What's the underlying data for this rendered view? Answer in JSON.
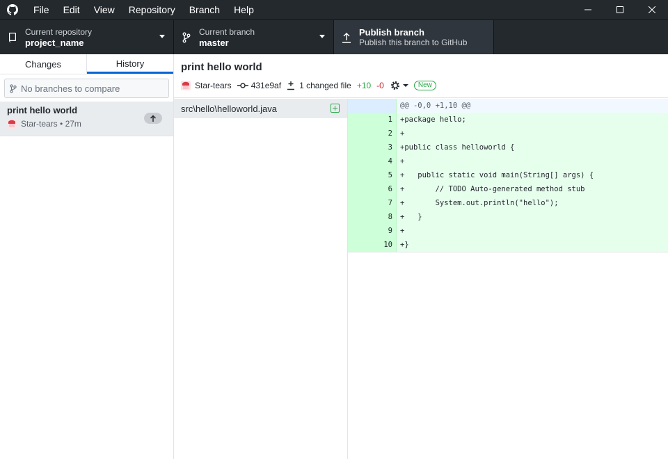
{
  "menu": [
    "File",
    "Edit",
    "View",
    "Repository",
    "Branch",
    "Help"
  ],
  "toolbar": {
    "repo_label": "Current repository",
    "repo_value": "project_name",
    "branch_label": "Current branch",
    "branch_value": "master",
    "publish_label": "Publish branch",
    "publish_desc": "Publish this branch to GitHub"
  },
  "sidebar": {
    "tabs": [
      "Changes",
      "History"
    ],
    "active_tab": "History",
    "compare_placeholder": "No branches to compare",
    "commit": {
      "title": "print hello world",
      "author": "Star-tears",
      "time": "27m"
    }
  },
  "main": {
    "title": "print hello world",
    "author": "Star-tears",
    "sha": "431e9af",
    "changed_files": "1 changed file",
    "additions": "+10",
    "deletions": "-0",
    "new_badge": "New",
    "file": "src\\hello\\helloworld.java"
  },
  "diff": {
    "hunk": "@@ -0,0 +1,10 @@",
    "lines": [
      {
        "n": "1",
        "text": "+package hello;"
      },
      {
        "n": "2",
        "text": "+"
      },
      {
        "n": "3",
        "text": "+public class helloworld {"
      },
      {
        "n": "4",
        "text": "+"
      },
      {
        "n": "5",
        "text": "+   public static void main(String[] args) {"
      },
      {
        "n": "6",
        "text": "+       // TODO Auto-generated method stub"
      },
      {
        "n": "7",
        "text": "+       System.out.println(\"hello\");"
      },
      {
        "n": "8",
        "text": "+   }"
      },
      {
        "n": "9",
        "text": "+"
      },
      {
        "n": "10",
        "text": "+}"
      }
    ]
  },
  "colors": {
    "titlebar": "#24292e",
    "accent": "#0366d6",
    "added": "#28a745",
    "removed": "#cb2431"
  }
}
